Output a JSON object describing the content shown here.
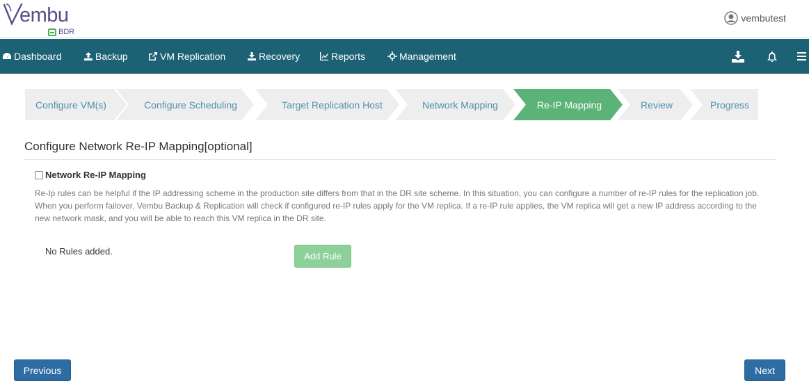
{
  "app": {
    "logo_text": "embu",
    "logo_sub": "BDR"
  },
  "user": {
    "name": "vembutest"
  },
  "nav": {
    "items": [
      {
        "label": "Dashboard",
        "icon": "dashboard-icon"
      },
      {
        "label": "Backup",
        "icon": "upload-icon"
      },
      {
        "label": "VM Replication",
        "icon": "share-icon"
      },
      {
        "label": "Recovery",
        "icon": "download-icon"
      },
      {
        "label": "Reports",
        "icon": "chart-icon"
      },
      {
        "label": "Management",
        "icon": "crosshair-icon"
      }
    ],
    "right_icons": [
      "download-tray-icon",
      "bell-icon",
      "menu-icon"
    ]
  },
  "wizard": {
    "steps": [
      {
        "label": "Configure VM(s)"
      },
      {
        "label": "Configure Scheduling"
      },
      {
        "label": "Target Replication Host"
      },
      {
        "label": "Network Mapping"
      },
      {
        "label": "Re-IP Mapping"
      },
      {
        "label": "Review"
      },
      {
        "label": "Progress"
      }
    ],
    "active_step": "Re-IP Mapping"
  },
  "content": {
    "title": "Configure Network Re-IP Mapping[optional]",
    "checkbox_label": "Network Re-IP Mapping",
    "checkbox_checked": false,
    "description": "Re-Ip rules can be helpful if the IP addressing scheme in the production site differs from that in the DR site scheme. In this situation, you can configure a number of re-IP rules for the replication job. When you perform failover, Vembu Backup & Replication will check if configured re-IP rules apply for the VM replica. If a re-IP rule applies, the VM replica will get a new IP address according to the new network mask, and you will be able to reach this VM replica in the DR site.",
    "no_rules": "No Rules added.",
    "add_rule_label": "Add Rule"
  },
  "footer": {
    "previous_label": "Previous",
    "next_label": "Next"
  },
  "colors": {
    "nav_bg": "#1d6274",
    "active_step": "#5cb377",
    "primary_button": "#2e6da4",
    "brand_purple": "#5c4a8a"
  }
}
